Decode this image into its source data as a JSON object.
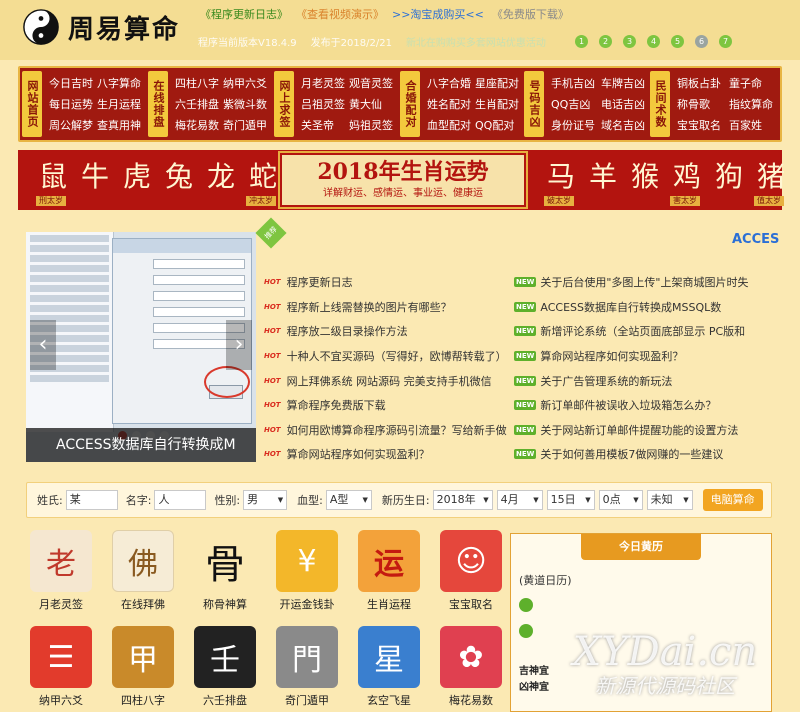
{
  "header": {
    "logo_text": "周易算命",
    "top_links": [
      {
        "text": "《程序更新日志》",
        "color": "green"
      },
      {
        "text": "《查看视频演示》",
        "color": "orange"
      },
      {
        "text": ">>淘宝成购买<<",
        "color": "blue"
      },
      {
        "text": "《免费版下载》",
        "color": "gray"
      }
    ],
    "version": "程序当前版本V18.4.9",
    "released": "发布于2018/2/21",
    "notice": "新北在购购买多套网站优惠活动",
    "dots": [
      "1",
      "2",
      "3",
      "4",
      "5",
      "6",
      "7"
    ]
  },
  "nav": {
    "groups": [
      {
        "head": "网站首页",
        "links": [
          "今日吉时",
          "八字算命",
          "每日运势",
          "生月运程",
          "周公解梦",
          "查真用神"
        ]
      },
      {
        "head": "在线排盘",
        "links": [
          "四柱八字",
          "纳甲六爻",
          "六壬排盘",
          "紫微斗数",
          "梅花易数",
          "奇门遁甲"
        ]
      },
      {
        "head": "网上求签",
        "links": [
          "月老灵签",
          "观音灵签",
          "吕祖灵签",
          "黄大仙",
          "关圣帝",
          "妈祖灵签"
        ]
      },
      {
        "head": "合婚配对",
        "links": [
          "八字合婚",
          "星座配对",
          "姓名配对",
          "生肖配对",
          "血型配对",
          "QQ配对"
        ]
      },
      {
        "head": "号码吉凶",
        "links": [
          "手机吉凶",
          "车牌吉凶",
          "QQ吉凶",
          "电话吉凶",
          "身份证号",
          "域名吉凶"
        ]
      },
      {
        "head": "民间术数",
        "links": [
          "铜板占卦",
          "童子命",
          "称骨歌",
          "指纹算命",
          "宝宝取名",
          "百家姓"
        ]
      }
    ]
  },
  "zodiac": {
    "left": [
      {
        "animal": "鼠",
        "tag": "刑太岁"
      },
      {
        "animal": "牛",
        "tag": ""
      },
      {
        "animal": "虎",
        "tag": ""
      },
      {
        "animal": "兔",
        "tag": ""
      },
      {
        "animal": "龙",
        "tag": ""
      },
      {
        "animal": "蛇",
        "tag": "冲太岁"
      }
    ],
    "right": [
      {
        "animal": "马",
        "tag": "破太岁"
      },
      {
        "animal": "羊",
        "tag": ""
      },
      {
        "animal": "猴",
        "tag": ""
      },
      {
        "animal": "鸡",
        "tag": "害太岁"
      },
      {
        "animal": "狗",
        "tag": ""
      },
      {
        "animal": "猪",
        "tag": "值太岁"
      }
    ],
    "title": "2018年生肖运势",
    "subtitle": "详解财运、感情运、事业运、健康运"
  },
  "slider": {
    "caption": "ACCESS数据库自行转换成M",
    "prev_icon": "chevron-left-icon",
    "next_icon": "chevron-right-icon"
  },
  "news": {
    "ribbon": "推荐",
    "marquee": "ACCES",
    "hot_label": "HOT",
    "new_label": "NEW",
    "left": [
      "程序更新日志",
      "程序新上线需替换的图片有哪些？",
      "程序放二级目录操作方法",
      "十种人不宜买源码（写得好，欧博帮转载了）",
      "网上拜佛系统 网站源码 完美支持手机微信",
      "算命程序免费版下载",
      "如何用欧博算命程序源码引流量？写给新手做",
      "算命网站程序如何实现盈利？"
    ],
    "right": [
      "关于后台使用\"多图上传\"上架商城图片时失",
      "ACCESS数据库自行转换成MSSQL数",
      "新增评论系统（全站页面底部显示 PC版和",
      "算命网站程序如何实现盈利？",
      "关于广告管理系统的新玩法",
      "新订单邮件被误收入垃圾箱怎么办？",
      "关于网站新订单邮件提醒功能的设置方法",
      "关于如何善用模板7做网赚的一些建议"
    ]
  },
  "form": {
    "surname_label": "姓氏:",
    "surname_value": "某",
    "name_label": "名字:",
    "name_value": "人",
    "gender_label": "性别:",
    "gender_value": "男",
    "blood_label": "血型:",
    "blood_value": "A型",
    "birth_label": "新历生日:",
    "year_value": "2018年",
    "month_value": "4月",
    "day_value": "15日",
    "hour_value": "0点",
    "minute_value": "未知",
    "submit_label": "电脑算命"
  },
  "tiles": [
    {
      "label": "月老灵签",
      "icon": "matchmaker-icon",
      "glyph": "老",
      "color": "#c0392b"
    },
    {
      "label": "在线拜佛",
      "icon": "buddha-icon",
      "glyph": "佛",
      "color": "#c8a060"
    },
    {
      "label": "称骨神算",
      "icon": "bone-icon",
      "glyph": "骨",
      "color": "#ffffff"
    },
    {
      "label": "开运金钱卦",
      "icon": "coin-icon",
      "glyph": "¥",
      "color": "#f0b400"
    },
    {
      "label": "生肖运程",
      "icon": "zodiac-icon",
      "glyph": "运",
      "color": "#f07a10"
    },
    {
      "label": "宝宝取名",
      "icon": "baby-icon",
      "glyph": "☺",
      "color": "#e04040"
    },
    {
      "label": "纳甲六爻",
      "icon": "hexagram-icon",
      "glyph": "☰",
      "color": "#e23b2c"
    },
    {
      "label": "四柱八字",
      "icon": "pillars-icon",
      "glyph": "甲",
      "color": "#f09a2a"
    },
    {
      "label": "六壬排盘",
      "icon": "liuren-icon",
      "glyph": "壬",
      "color": "#222222"
    },
    {
      "label": "奇门遁甲",
      "icon": "door-icon",
      "glyph": "門",
      "color": "#8a8a8a"
    },
    {
      "label": "玄空飞星",
      "icon": "star-grid-icon",
      "glyph": "星",
      "color": "#3a7fcf"
    },
    {
      "label": "梅花易数",
      "icon": "plum-flower-icon",
      "glyph": "✿",
      "color": "#e04050"
    }
  ],
  "calendar": {
    "title": "今日黄历",
    "label": "(黄道日历)",
    "lucky": "吉神宜",
    "evil": "凶神宜"
  },
  "watermark": {
    "line1": "XYDai.cn",
    "line2": "新源代源码社区"
  },
  "colors": {
    "nav_bg": "#a01a10",
    "nav_head": "#f3c93d",
    "banner_red": "#b3140f",
    "accent_orange": "#f2a521",
    "new_green": "#5eb02b"
  }
}
